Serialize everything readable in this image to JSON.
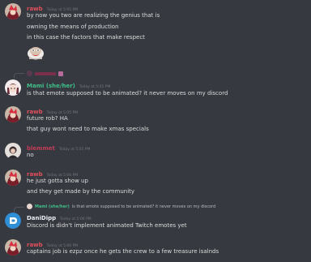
{
  "colors": {
    "background": "#36393f",
    "rawb": "#e24e5c",
    "mami": "#3fbf8a",
    "blem": "#c23d58",
    "dani": "#e9eef5",
    "timestamp": "#72767d",
    "text": "#dcddde"
  },
  "messages": [
    {
      "author": "rawb",
      "timestamp": "Today at 5:05 PM",
      "lines": [
        "by now you two are realizing the genius that is",
        "owning the means of production",
        "in this case the factors that make respect"
      ],
      "emote": "pepe-emote"
    },
    {
      "reply_to_text": "",
      "author": "Mami (she/her)",
      "timestamp": "Today at 5:05 PM",
      "lines": [
        "is that emote supposed to be animated? it never moves on my discord"
      ]
    },
    {
      "author": "rawb",
      "timestamp": "Today at 5:05 PM",
      "lines": [
        "future rob? HA",
        "that guy wont need to make xmas specials"
      ]
    },
    {
      "author": "blemmet",
      "timestamp": "Today at 5:05 PM",
      "lines": [
        "no"
      ]
    },
    {
      "author": "rawb",
      "timestamp": "Today at 5:06 PM",
      "lines": [
        "he just gotta show up",
        "and they get made by the community"
      ]
    },
    {
      "reply_to_author": "Mami (she/her)",
      "reply_to_text": "is that emote supposed to be animated? it never moves on my discord",
      "author": "DaniDipp",
      "timestamp": "Today at 5:06 PM",
      "lines": [
        "Discord is didn't implement animated Twitch emotes yet"
      ]
    },
    {
      "author": "rawb",
      "timestamp": "Today at 5:06 PM",
      "lines": [
        "captains job is ezpz once he gets the crew to a few treasure isalnds"
      ]
    }
  ]
}
